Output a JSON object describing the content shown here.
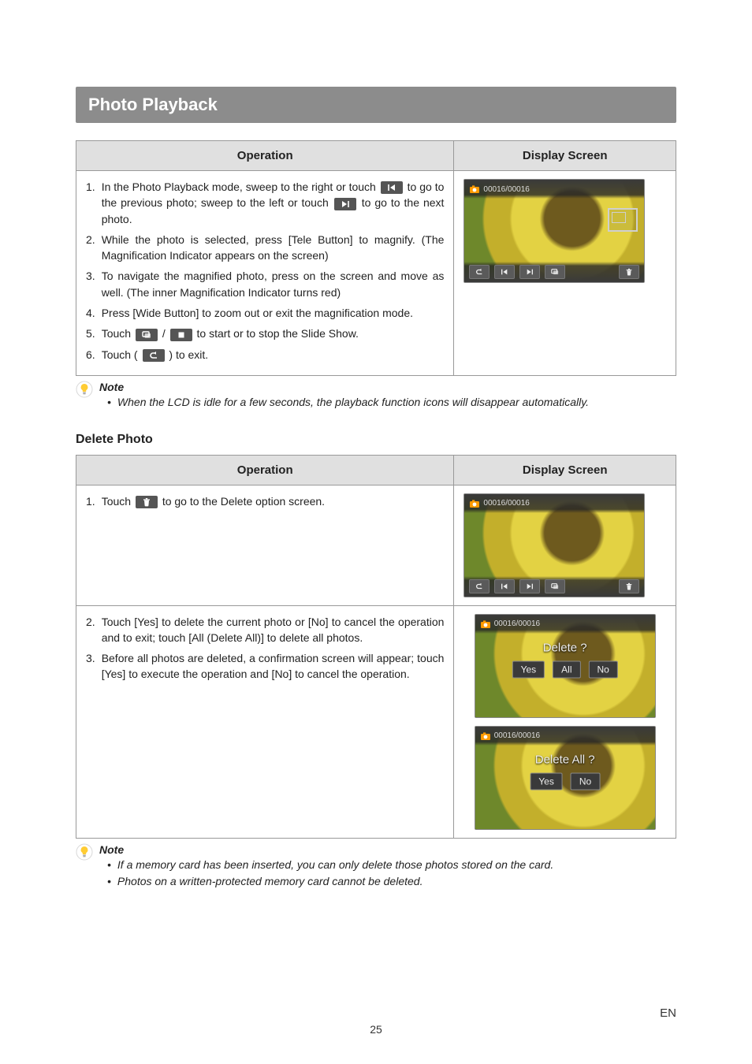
{
  "section_title": "Photo Playback",
  "table1": {
    "headers": {
      "operation": "Operation",
      "display": "Display Screen"
    },
    "steps": [
      {
        "pre": "In the Photo Playback mode, sweep to the right or touch ",
        "mid": " to go to the previous photo; sweep to the left or touch ",
        "post": " to go to the next photo."
      },
      {
        "text": "While the photo is selected, press [Tele Button] to magnify. (The Magnification Indicator appears on the screen)"
      },
      {
        "text": "To navigate the magnified photo, press on the screen and move as well. (The inner Magnification Indicator turns red)"
      },
      {
        "text": "Press [Wide Button] to zoom out or exit the magnification mode."
      },
      {
        "pre": "Touch ",
        "mid": " / ",
        "post": " to start or to stop the Slide Show."
      },
      {
        "pre": "Touch ( ",
        "post": " ) to exit."
      }
    ],
    "counter": "00016/00016"
  },
  "note1": {
    "title": "Note",
    "lines": [
      "When the LCD is idle for a few seconds, the playback function icons will disappear automatically."
    ]
  },
  "subheading": "Delete Photo",
  "table2": {
    "headers": {
      "operation": "Operation",
      "display": "Display Screen"
    },
    "step1": {
      "pre": "Touch ",
      "post": " to go to the Delete option screen."
    },
    "step2": "Touch [Yes] to delete the current photo or [No] to cancel the operation and to exit; touch [All (Delete All)] to delete all photos.",
    "step3": "Before all photos are deleted, a confirmation screen will appear; touch [Yes] to execute the operation and [No] to cancel the operation.",
    "counter1": "00016/00016",
    "counter2": "00016/00016",
    "counter3": "00016/00016",
    "delete_q": "Delete ?",
    "delete_all_q": "Delete All ?",
    "yes": "Yes",
    "no": "No",
    "all": "All"
  },
  "note2": {
    "title": "Note",
    "lines": [
      "If a memory card has been inserted, you can only delete those photos stored on the card.",
      "Photos on a written-protected memory card cannot be deleted."
    ]
  },
  "page_number": "25",
  "lang": "EN"
}
